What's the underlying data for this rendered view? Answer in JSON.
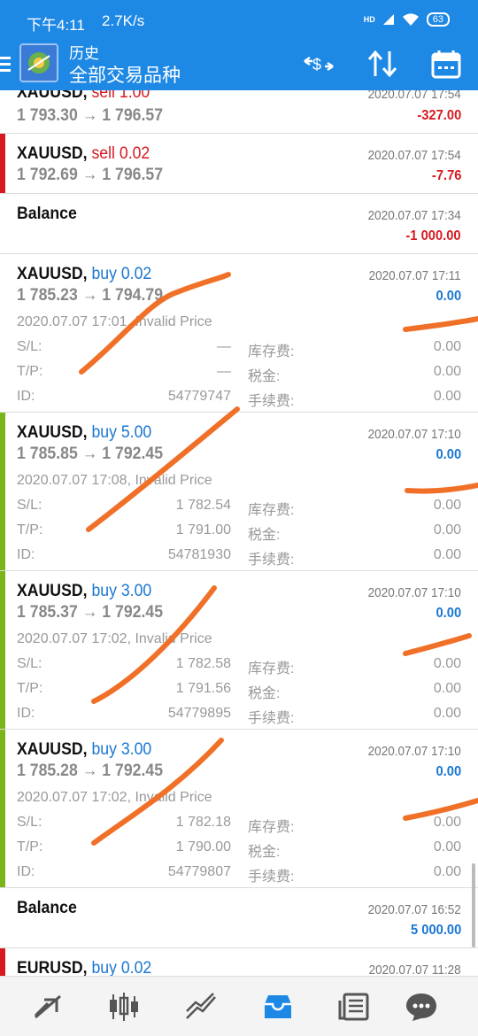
{
  "status_bar": {
    "time": "下午4:11",
    "speed": "2.7K/s",
    "network": "HD",
    "battery": "63"
  },
  "app_bar": {
    "title": "历史",
    "subtitle": "全部交易品种"
  },
  "items": [
    {
      "symbol": "XAUUSD,",
      "direction": "sell 1.00",
      "dir_type": "sell",
      "prices": "1 793.30 → 1 796.57",
      "datetime": "2020.07.07 17:54",
      "profit": "-327.00",
      "profit_type": "neg",
      "bar_color": ""
    },
    {
      "symbol": "XAUUSD,",
      "direction": "sell 0.02",
      "dir_type": "sell",
      "prices": "1 792.69 → 1 796.57",
      "datetime": "2020.07.07 17:54",
      "profit": "-7.76",
      "profit_type": "neg",
      "bar_color": "#d71920"
    },
    {
      "symbol": "Balance",
      "direction": "",
      "dir_type": "",
      "prices": "",
      "datetime": "2020.07.07 17:34",
      "profit": "-1 000.00",
      "profit_type": "neg",
      "bar_color": ""
    },
    {
      "symbol": "XAUUSD,",
      "direction": "buy 0.02",
      "dir_type": "buy",
      "prices": "1 785.23 → 1 794.79",
      "datetime": "2020.07.07 17:11",
      "profit": "0.00",
      "profit_type": "pos",
      "bar_color": "",
      "comment": "2020.07.07 17:01, Invalid Price",
      "sl": "—",
      "tp": "—",
      "id": "54779747",
      "swap": "0.00",
      "tax": "0.00",
      "fee": "0.00"
    },
    {
      "symbol": "XAUUSD,",
      "direction": "buy 5.00",
      "dir_type": "buy",
      "prices": "1 785.85 → 1 792.45",
      "datetime": "2020.07.07 17:10",
      "profit": "0.00",
      "profit_type": "pos",
      "bar_color": "#7cb518",
      "comment": "2020.07.07 17:08, Invalid Price",
      "sl": "1 782.54",
      "tp": "1 791.00",
      "id": "54781930",
      "swap": "0.00",
      "tax": "0.00",
      "fee": "0.00"
    },
    {
      "symbol": "XAUUSD,",
      "direction": "buy 3.00",
      "dir_type": "buy",
      "prices": "1 785.37 → 1 792.45",
      "datetime": "2020.07.07 17:10",
      "profit": "0.00",
      "profit_type": "pos",
      "bar_color": "#7cb518",
      "comment": "2020.07.07 17:02, Invalid Price",
      "sl": "1 782.58",
      "tp": "1 791.56",
      "id": "54779895",
      "swap": "0.00",
      "tax": "0.00",
      "fee": "0.00"
    },
    {
      "symbol": "XAUUSD,",
      "direction": "buy 3.00",
      "dir_type": "buy",
      "prices": "1 785.28 → 1 792.45",
      "datetime": "2020.07.07 17:10",
      "profit": "0.00",
      "profit_type": "pos",
      "bar_color": "#7cb518",
      "comment": "2020.07.07 17:02, Invalid Price",
      "sl": "1 782.18",
      "tp": "1 790.00",
      "id": "54779807",
      "swap": "0.00",
      "tax": "0.00",
      "fee": "0.00"
    },
    {
      "symbol": "Balance",
      "direction": "",
      "dir_type": "",
      "prices": "",
      "datetime": "2020.07.07 16:52",
      "profit": "5 000.00",
      "profit_type": "pos",
      "bar_color": ""
    },
    {
      "symbol": "EURUSD,",
      "direction": "buy 0.02",
      "dir_type": "buy",
      "prices": "",
      "datetime": "2020.07.07 11:28",
      "profit": "",
      "profit_type": "pos",
      "bar_color": "#d71920"
    }
  ],
  "labels": {
    "sl": "S/L:",
    "tp": "T/P:",
    "id": "ID:",
    "swap": "库存费:",
    "tax": "税金:",
    "fee": "手续费:"
  },
  "colors": {
    "primary": "#1e88e5",
    "sell": "#d71920",
    "buy": "#1976d2",
    "annotation": "#f07028"
  },
  "bottom_nav": [
    "trade-icon",
    "quotes-icon",
    "chart-icon",
    "history-icon",
    "news-icon",
    "chat-icon"
  ]
}
